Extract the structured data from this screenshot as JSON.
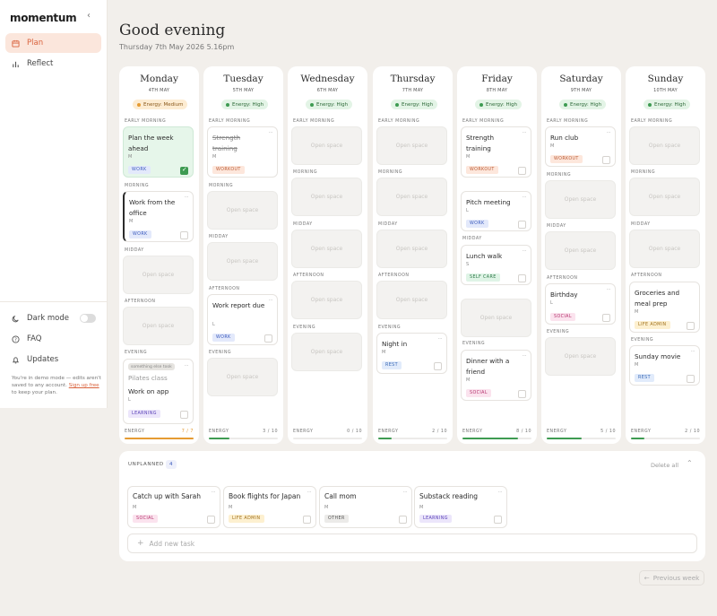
{
  "sidebar": {
    "logo": "momentum",
    "nav": [
      {
        "label": "Plan"
      },
      {
        "label": "Reflect"
      }
    ],
    "bottom": {
      "dark_mode": "Dark mode",
      "faq": "FAQ",
      "updates": "Updates"
    },
    "demo_note": {
      "pre": "You're in demo mode — edits aren't saved to any account. ",
      "link": "Sign up free",
      "post": " to keep your plan."
    }
  },
  "header": {
    "greeting": "Good evening",
    "datetime": "Thursday 7th May 2026 5.16pm"
  },
  "sections": {
    "early_morning": "EARLY MORNING",
    "morning": "MORNING",
    "midday": "MIDDAY",
    "afternoon": "AFTERNOON",
    "evening": "EVENING"
  },
  "open_space": "Open space",
  "energy_label": "ENERGY",
  "days": [
    {
      "name": "Monday",
      "date": "4TH MAY",
      "energy": "Energy: Medium",
      "energy_value": "7 / 7"
    },
    {
      "name": "Tuesday",
      "date": "5TH MAY",
      "energy": "Energy: High",
      "energy_value": "3 / 10"
    },
    {
      "name": "Wednesday",
      "date": "6TH MAY",
      "energy": "Energy: High",
      "energy_value": "0 / 10"
    },
    {
      "name": "Thursday",
      "date": "7TH MAY",
      "energy": "Energy: High",
      "energy_value": "2 / 10"
    },
    {
      "name": "Friday",
      "date": "8TH MAY",
      "energy": "Energy: High",
      "energy_value": "8 / 10"
    },
    {
      "name": "Saturday",
      "date": "9TH MAY",
      "energy": "Energy: High",
      "energy_value": "5 / 10"
    },
    {
      "name": "Sunday",
      "date": "10TH MAY",
      "energy": "Energy: High",
      "energy_value": "2 / 10"
    }
  ],
  "energy_fraction": [
    1.0,
    0.3,
    0.0,
    0.2,
    0.8,
    0.5,
    0.2
  ],
  "tasks": {
    "mon_plan": {
      "title": "Plan the week ahead",
      "meta": "M",
      "tag": "WORK"
    },
    "mon_office": {
      "title": "Work from the office",
      "meta": "M",
      "tag": "WORK"
    },
    "mon_drag": "something else took",
    "mon_pilates": "Pilates class",
    "mon_workapp": {
      "title": "Work on app",
      "meta": "L",
      "tag": "LEARNING"
    },
    "tue_strength": {
      "title": "Strength training",
      "meta": "M",
      "tag": "WORKOUT"
    },
    "tue_report": {
      "title": "Work report due",
      "meta": "L",
      "tag": "WORK"
    },
    "thu_night": {
      "title": "Night in",
      "meta": "M",
      "tag": "REST"
    },
    "fri_strength": {
      "title": "Strength training",
      "meta": "M",
      "tag": "WORKOUT"
    },
    "fri_pitch": {
      "title": "Pitch meeting",
      "meta": "L",
      "tag": "WORK"
    },
    "fri_lunch": {
      "title": "Lunch walk",
      "meta": "S",
      "tag": "SELF CARE"
    },
    "fri_dinner": {
      "title": "Dinner with a friend",
      "meta": "M",
      "tag": "SOCIAL"
    },
    "sat_run": {
      "title": "Run club",
      "meta": "M",
      "tag": "WORKOUT"
    },
    "sat_birthday": {
      "title": "Birthday",
      "meta": "L",
      "tag": "SOCIAL"
    },
    "sun_groceries": {
      "title": "Groceries and meal prep",
      "meta": "M",
      "tag": "LIFE ADMIN"
    },
    "sun_movie": {
      "title": "Sunday movie",
      "meta": "M",
      "tag": "REST"
    }
  },
  "unplanned": {
    "label": "UNPLANNED",
    "count": "4",
    "delete_all": "Delete all",
    "items": [
      {
        "title": "Catch up with Sarah",
        "meta": "M",
        "tag": "SOCIAL"
      },
      {
        "title": "Book flights for Japan",
        "meta": "M",
        "tag": "LIFE ADMIN"
      },
      {
        "title": "Call mom",
        "meta": "M",
        "tag": "OTHER"
      },
      {
        "title": "Substack reading",
        "meta": "M",
        "tag": "LEARNING"
      }
    ],
    "add_placeholder": "Add new task"
  },
  "prev_week": "Previous week",
  "colors": {
    "accent": "#d9623c",
    "energy_green": "#3e9b52",
    "energy_orange": "#e59b33"
  }
}
